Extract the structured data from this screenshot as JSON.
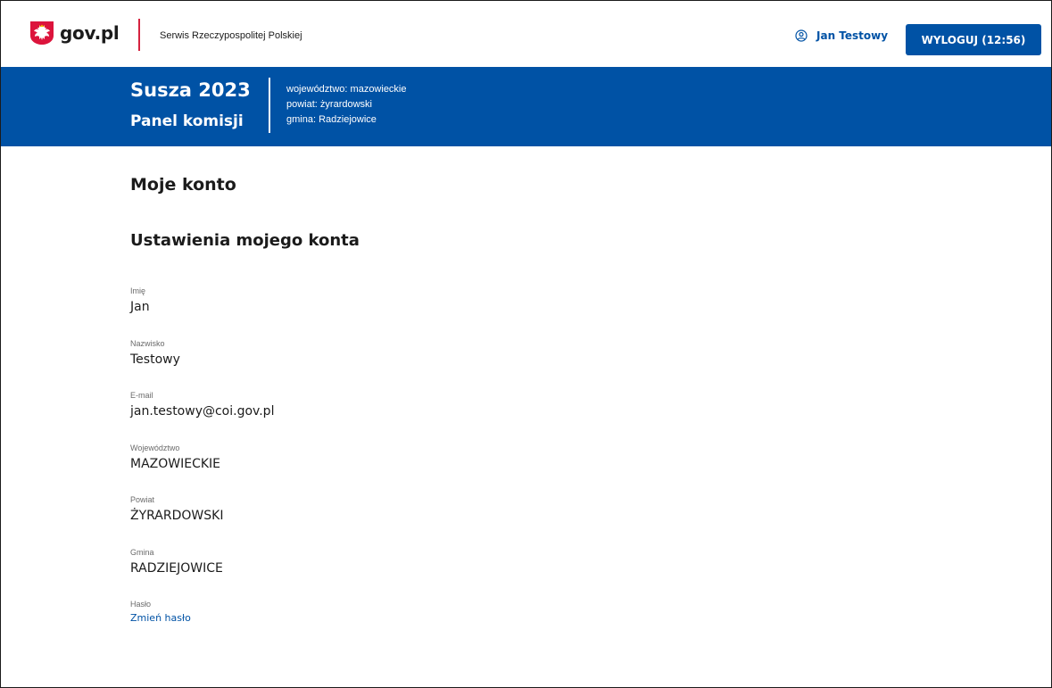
{
  "header": {
    "logo_text": "gov.pl",
    "service_name": "Serwis Rzeczypospolitej Polskiej",
    "user_name": "Jan Testowy",
    "logout_label": "WYLOGUJ (12:56)",
    "icons": {
      "emblem": "polish-eagle-emblem",
      "user": "user-circle-icon"
    },
    "colors": {
      "accent": "#0052a5",
      "separator": "#d5233f",
      "emblem_red": "#dc143c"
    }
  },
  "banner": {
    "title": "Susza 2023",
    "subtitle": "Panel komisji",
    "region": {
      "wojewodztwo": "województwo: mazowieckie",
      "powiat": "powiat: żyrardowski",
      "gmina": "gmina: Radziejowice"
    }
  },
  "main": {
    "page_title": "Moje konto",
    "section_title": "Ustawienia mojego konta",
    "fields": [
      {
        "label": "Imię",
        "value": "Jan"
      },
      {
        "label": "Nazwisko",
        "value": "Testowy"
      },
      {
        "label": "E-mail",
        "value": "jan.testowy@coi.gov.pl"
      },
      {
        "label": "Województwo",
        "value": "MAZOWIECKIE"
      },
      {
        "label": "Powiat",
        "value": "ŻYRARDOWSKI"
      },
      {
        "label": "Gmina",
        "value": "RADZIEJOWICE"
      }
    ],
    "password": {
      "label": "Hasło",
      "link": "Zmień hasło"
    }
  }
}
